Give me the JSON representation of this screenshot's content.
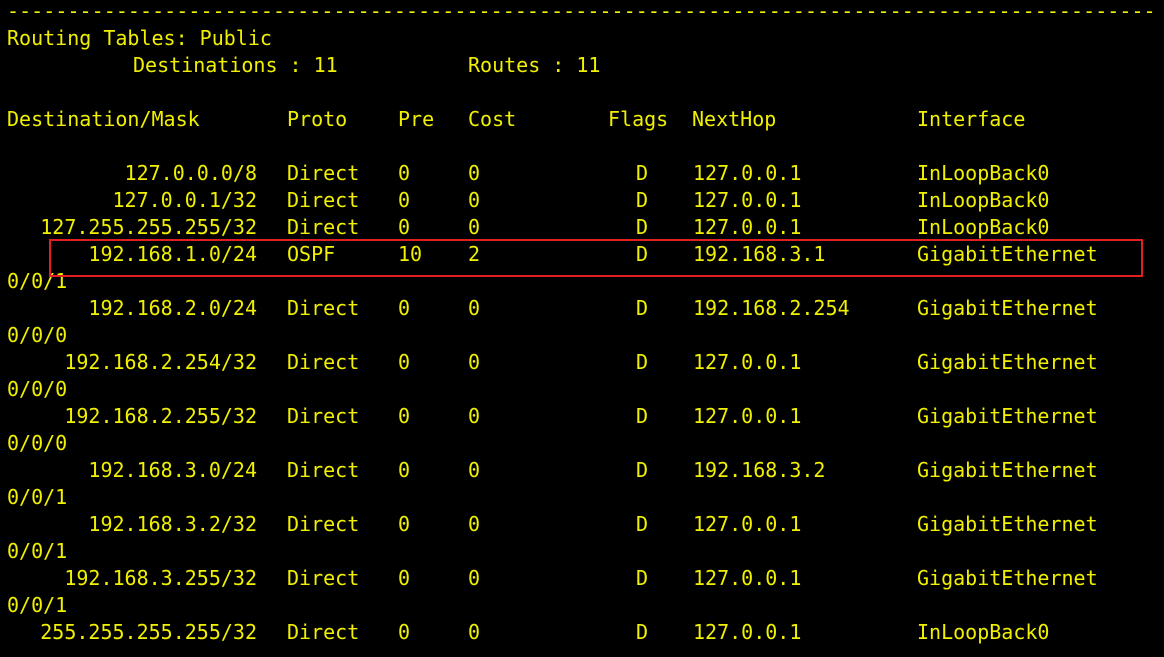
{
  "separator": "-----------------------------------------------------------------------------------------------",
  "title": "Routing Tables: Public",
  "summary": {
    "destinations_label": "Destinations : 11",
    "routes_label": "Routes : 11"
  },
  "headers": {
    "destination": "Destination/Mask",
    "proto": "Proto",
    "pre": "Pre",
    "cost": "Cost",
    "flags": "Flags",
    "nexthop": "NextHop",
    "interface": "Interface"
  },
  "routes": [
    {
      "dest": "127.0.0.0/8",
      "proto": "Direct",
      "pre": "0",
      "cost": "0",
      "flags": "D",
      "nexthop": "127.0.0.1",
      "intf": "InLoopBack0",
      "intf_cont": ""
    },
    {
      "dest": "127.0.0.1/32",
      "proto": "Direct",
      "pre": "0",
      "cost": "0",
      "flags": "D",
      "nexthop": "127.0.0.1",
      "intf": "InLoopBack0",
      "intf_cont": ""
    },
    {
      "dest": "127.255.255.255/32",
      "proto": "Direct",
      "pre": "0",
      "cost": "0",
      "flags": "D",
      "nexthop": "127.0.0.1",
      "intf": "InLoopBack0",
      "intf_cont": ""
    },
    {
      "dest": "192.168.1.0/24",
      "proto": "OSPF",
      "pre": "10",
      "cost": "2",
      "flags": "D",
      "nexthop": "192.168.3.1",
      "intf": "GigabitEthernet",
      "intf_cont": "0/0/1"
    },
    {
      "dest": "192.168.2.0/24",
      "proto": "Direct",
      "pre": "0",
      "cost": "0",
      "flags": "D",
      "nexthop": "192.168.2.254",
      "intf": "GigabitEthernet",
      "intf_cont": "0/0/0"
    },
    {
      "dest": "192.168.2.254/32",
      "proto": "Direct",
      "pre": "0",
      "cost": "0",
      "flags": "D",
      "nexthop": "127.0.0.1",
      "intf": "GigabitEthernet",
      "intf_cont": "0/0/0"
    },
    {
      "dest": "192.168.2.255/32",
      "proto": "Direct",
      "pre": "0",
      "cost": "0",
      "flags": "D",
      "nexthop": "127.0.0.1",
      "intf": "GigabitEthernet",
      "intf_cont": "0/0/0"
    },
    {
      "dest": "192.168.3.0/24",
      "proto": "Direct",
      "pre": "0",
      "cost": "0",
      "flags": "D",
      "nexthop": "192.168.3.2",
      "intf": "GigabitEthernet",
      "intf_cont": "0/0/1"
    },
    {
      "dest": "192.168.3.2/32",
      "proto": "Direct",
      "pre": "0",
      "cost": "0",
      "flags": "D",
      "nexthop": "127.0.0.1",
      "intf": "GigabitEthernet",
      "intf_cont": "0/0/1"
    },
    {
      "dest": "192.168.3.255/32",
      "proto": "Direct",
      "pre": "0",
      "cost": "0",
      "flags": "D",
      "nexthop": "127.0.0.1",
      "intf": "GigabitEthernet",
      "intf_cont": "0/0/1"
    },
    {
      "dest": "255.255.255.255/32",
      "proto": "Direct",
      "pre": "0",
      "cost": "0",
      "flags": "D",
      "nexthop": "127.0.0.1",
      "intf": "InLoopBack0",
      "intf_cont": ""
    }
  ],
  "colors": {
    "background": "#000000",
    "text": "#f0f000",
    "highlight_border": "#e02020"
  }
}
